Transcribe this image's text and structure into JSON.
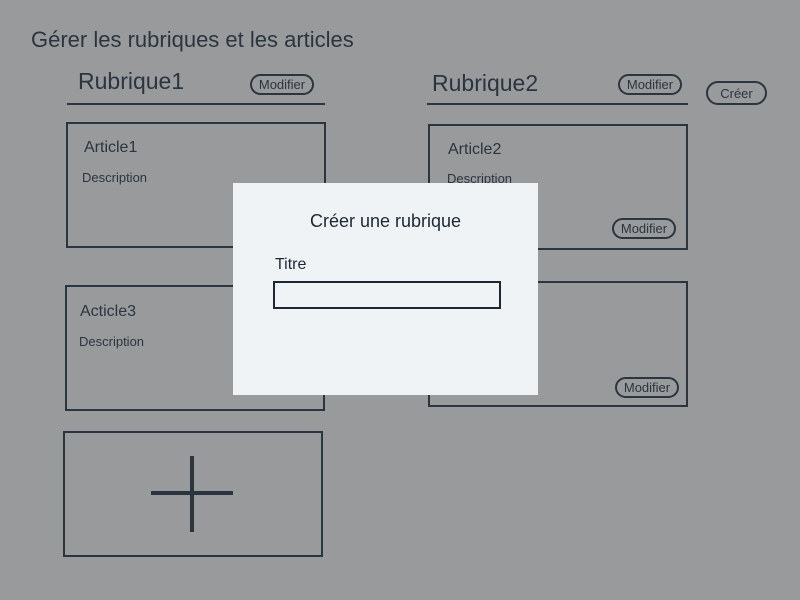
{
  "page": {
    "title": "Gérer les rubriques et les articles",
    "create_label": "Créer"
  },
  "columns": [
    {
      "title": "Rubrique1",
      "edit_label": "Modifier",
      "articles": [
        {
          "title": "Article1",
          "description": "Description"
        },
        {
          "title": "Acticle3",
          "description": "Description"
        }
      ]
    },
    {
      "title": "Rubrique2",
      "edit_label": "Modifier",
      "articles": [
        {
          "title": "Article2",
          "description": "Description",
          "edit_label": "Modifier"
        },
        {
          "edit_label": "Modifier"
        }
      ]
    }
  ],
  "add_article": {
    "icon": "plus-icon"
  },
  "modal": {
    "title": "Créer une rubrique",
    "field_label": "Titre",
    "field_value": ""
  },
  "colors": {
    "background": "#999a9c",
    "ink": "#2a3540",
    "modal_background": "#eff3f6"
  }
}
